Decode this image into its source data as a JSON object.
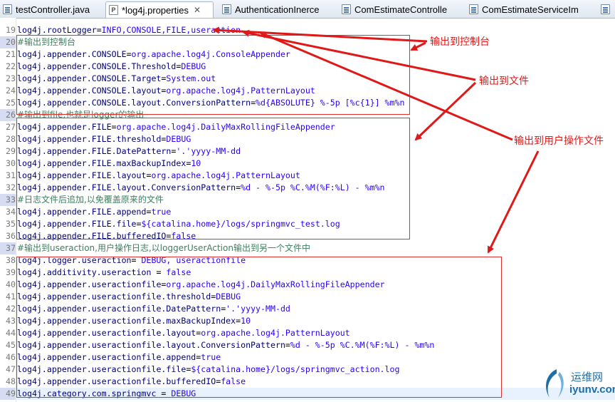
{
  "tabs": [
    {
      "label": "testController.java",
      "icon": "java-file-icon",
      "active": false
    },
    {
      "label": "*log4j.properties",
      "icon": "properties-file-icon",
      "active": true
    },
    {
      "label": "AuthenticationInerce",
      "icon": "java-file-icon",
      "active": false
    },
    {
      "label": "ComEstimateControlle",
      "icon": "java-file-icon",
      "active": false
    },
    {
      "label": "ComEstimateServiceIm",
      "icon": "java-file-icon",
      "active": false
    },
    {
      "label": "",
      "icon": "java-file-icon",
      "active": false
    }
  ],
  "lines": [
    {
      "n": "19",
      "key": "log4j.rootLogger",
      "val": "INFO,CONSOLE,FILE,useraction"
    },
    {
      "n": "20",
      "comment": "#输出到控制台"
    },
    {
      "n": "21",
      "key": "log4j.appender.CONSOLE",
      "val": "org.apache.log4j.ConsoleAppender"
    },
    {
      "n": "22",
      "key": "log4j.appender.CONSOLE.Threshold",
      "val": "DEBUG"
    },
    {
      "n": "23",
      "key": "log4j.appender.CONSOLE.Target",
      "val": "System.out"
    },
    {
      "n": "24",
      "key": "log4j.appender.CONSOLE.layout",
      "val": "org.apache.log4j.PatternLayout"
    },
    {
      "n": "25",
      "key": "log4j.appender.CONSOLE.layout.ConversionPattern",
      "val": "%d{ABSOLUTE} %-5p [%c{1}] %m%n"
    },
    {
      "n": "26",
      "comment": "#输出到file,也就是logger的输出"
    },
    {
      "n": "27",
      "key": "log4j.appender.FILE",
      "val": "org.apache.log4j.DailyMaxRollingFileAppender"
    },
    {
      "n": "28",
      "key": "log4j.appender.FILE.threshold",
      "val": "DEBUG"
    },
    {
      "n": "29",
      "key": "log4j.appender.FILE.DatePattern",
      "val": "'.'yyyy-MM-dd"
    },
    {
      "n": "30",
      "key": "log4j.appender.FILE.maxBackupIndex",
      "val": "10"
    },
    {
      "n": "31",
      "key": "log4j.appender.FILE.layout",
      "val": "org.apache.log4j.PatternLayout"
    },
    {
      "n": "32",
      "key": "log4j.appender.FILE.layout.ConversionPattern",
      "val": "%d - %-5p %C.%M(%F:%L) - %m%n"
    },
    {
      "n": "33",
      "comment": "#日志文件后追加,以免覆盖原来的文件"
    },
    {
      "n": "34",
      "key": "log4j.appender.FILE.append",
      "val": "true"
    },
    {
      "n": "35",
      "key": "log4j.appender.FILE.file",
      "val": "${catalina.home}/logs/springmvc_test.log"
    },
    {
      "n": "36",
      "key": "log4j.appender.FILE.bufferedIO",
      "val": "false"
    },
    {
      "n": "37",
      "comment": "#输出到useraction,用户操作日志,以loggerUserAction输出到另一个文件中"
    },
    {
      "n": "38",
      "key": "log4j.logger.useraction",
      "val": " DEBUG, useractionfile"
    },
    {
      "n": "39",
      "key": "log4j.additivity.useraction ",
      "val": " false"
    },
    {
      "n": "40",
      "key": "log4j.appender.useractionfile",
      "val": "org.apache.log4j.DailyMaxRollingFileAppender"
    },
    {
      "n": "41",
      "key": "log4j.appender.useractionfile.threshold",
      "val": "DEBUG"
    },
    {
      "n": "42",
      "key": "log4j.appender.useractionfile.DatePattern",
      "val": "'.'yyyy-MM-dd"
    },
    {
      "n": "43",
      "key": "log4j.appender.useractionfile.maxBackupIndex",
      "val": "10"
    },
    {
      "n": "44",
      "key": "log4j.appender.useractionfile.layout",
      "val": "org.apache.log4j.PatternLayout"
    },
    {
      "n": "45",
      "key": "log4j.appender.useractionfile.layout.ConversionPattern",
      "val": "%d - %-5p %C.%M(%F:%L) - %m%n"
    },
    {
      "n": "46",
      "key": "log4j.appender.useractionfile.append",
      "val": "true"
    },
    {
      "n": "47",
      "key": "log4j.appender.useractionfile.file",
      "val": "${catalina.home}/logs/springmvc_action.log"
    },
    {
      "n": "48",
      "key": "log4j.appender.useractionfile.bufferedIO",
      "val": "false"
    },
    {
      "n": "49",
      "key": "log4j.category.com.springmvc ",
      "val": " DEBUG"
    }
  ],
  "annotations": {
    "console": "输出到控制台",
    "file": "输出到文件",
    "useraction": "输出到用户操作文件"
  },
  "watermark": {
    "cn": "运维网",
    "url": "iyunv.com"
  },
  "colors": {
    "annotation_red": "#e01818",
    "key_navy": "#000080",
    "value_blue": "#2a00ff",
    "comment_green": "#3f7f5f"
  }
}
